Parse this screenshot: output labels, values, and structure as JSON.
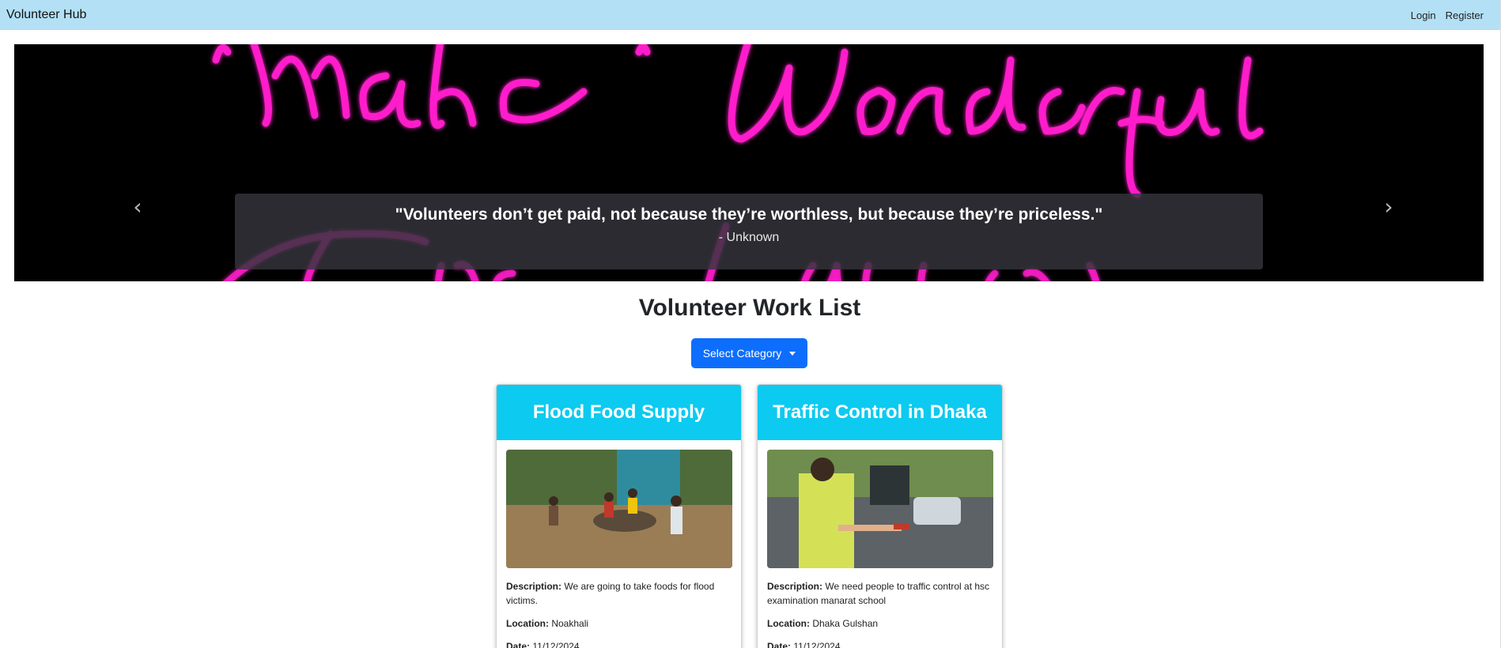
{
  "navbar": {
    "brand": "Volunteer Hub",
    "login_label": "Login",
    "register_label": "Register"
  },
  "carousel": {
    "quote": "\"Volunteers don’t get paid, not because they’re worthless, but because they’re priceless.\"",
    "author": "- Unknown",
    "prev_icon": "chevron-left-icon",
    "next_icon": "chevron-right-icon",
    "neon_color": "#ff1ecb"
  },
  "main": {
    "title": "Volunteer Work List",
    "dropdown_label": "Select Category"
  },
  "cards": [
    {
      "title": "Flood Food Supply",
      "description_label": "Description:",
      "description": "We are going to take foods for flood victims.",
      "location_label": "Location:",
      "location": "Noakhali",
      "date_label": "Date:",
      "date": "11/12/2024"
    },
    {
      "title": "Traffic Control in Dhaka",
      "description_label": "Description:",
      "description": "We need people to traffic control at hsc examination manarat school",
      "location_label": "Location:",
      "location": "Dhaka Gulshan",
      "date_label": "Date:",
      "date": "11/12/2024"
    }
  ],
  "colors": {
    "navbar_bg": "#b3e0f5",
    "card_header": "#0dcaf0",
    "primary_button": "#0d6efd"
  }
}
